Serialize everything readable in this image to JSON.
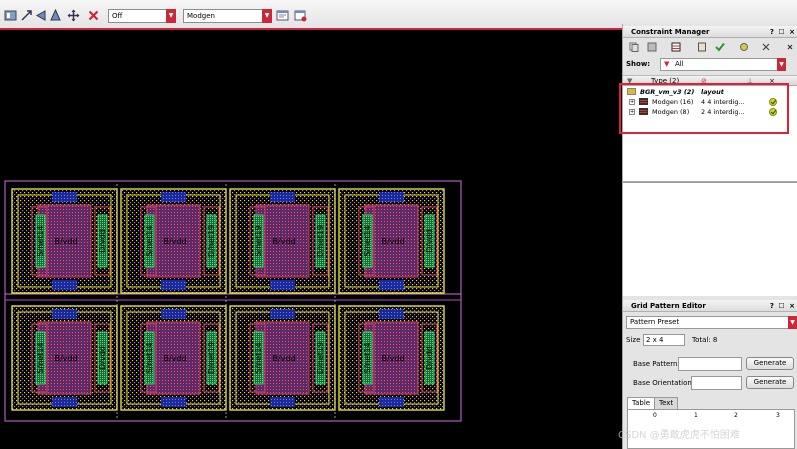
{
  "toolbar": {
    "icons": [
      "layout-icon",
      "stretch-icon",
      "flip-horizontal-icon",
      "flip-vertical-icon",
      "move-icon",
      "delete-icon"
    ],
    "combo_off": "Off",
    "combo_modgen": "Modgen",
    "tail_icons": [
      "window-icon",
      "browser-icon"
    ]
  },
  "constraint_manager": {
    "title": "Constraint Manager",
    "controls": "? ☐ ×",
    "show_label": "Show:",
    "show_value": "All",
    "columns": {
      "type": "Type (2)"
    },
    "tree": [
      {
        "name": "BGR_vm_v3 (2)",
        "value": "layout",
        "kind": "root"
      },
      {
        "name": "Modgen (16)",
        "value": "4 4 interdig...",
        "kind": "child"
      },
      {
        "name": "Modgen (8)",
        "value": "2 4 interdig...",
        "kind": "child"
      }
    ]
  },
  "grid_pattern_editor": {
    "title": "Grid Pattern Editor",
    "controls": "? ☐ ×",
    "preset": "Pattern Preset",
    "size_label": "Size",
    "size_value": "2 x 4",
    "total": "Total: 8",
    "base_pattern_label": "Base Pattern",
    "base_orientation_label": "Base Orientation",
    "generate": "Generate",
    "tabs": [
      "Table",
      "Text"
    ],
    "grid_cols": [
      "0",
      "1",
      "2",
      "3"
    ]
  },
  "layout": {
    "cell_labels": {
      "left": "S/net14",
      "center": "B/vdd",
      "right": "D/vdd",
      "left2": "S/net19",
      "right2": "D/net19"
    }
  },
  "watermark": "CSDN @勇敢虎虎不怕困难",
  "colors": {
    "accent": "#c8283a",
    "highlight": "#e0203a"
  }
}
